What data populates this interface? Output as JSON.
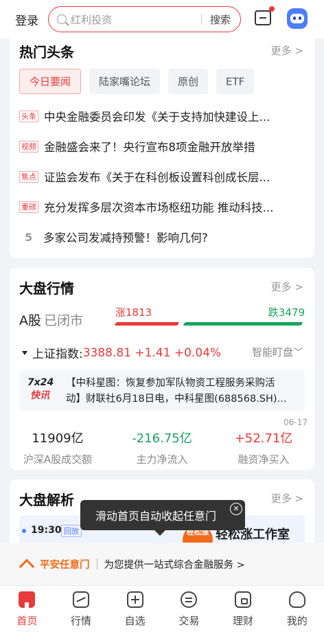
{
  "header": {
    "login": "登录",
    "search_placeholder": "红利投资",
    "search_button": "搜索"
  },
  "hot": {
    "title": "热门头条",
    "more": "更多 >",
    "tabs": [
      "今日要闻",
      "陆家嘴论坛",
      "原创",
      "ETF"
    ],
    "news": [
      {
        "tag": "头条",
        "text": "中央金融委员会印发《关于支持加快建设上..."
      },
      {
        "tag": "视频",
        "text": "金融盛会来了！央行宣布8项金融开放举措"
      },
      {
        "tag": "焦点",
        "text": "证监会发布《关于在科创板设置科创成长层..."
      },
      {
        "tag": "重磅",
        "text": "充分发挥多层次资本市场枢纽功能 推动科技..."
      },
      {
        "num": "5",
        "text": "多家公司发减持预警！影响几何?"
      }
    ]
  },
  "market": {
    "title": "大盘行情",
    "more": "更多 >",
    "ashare": "A股",
    "status": "已闭市",
    "rise_label": "涨1813",
    "fall_label": "跌3479",
    "rise_count": 1813,
    "fall_count": 3479,
    "index_name": "上证指数:",
    "index_value": "3388.81 +1.41 +0.04%",
    "smart": "智能盯盘﹀",
    "flash_logo_top": "7x24",
    "flash_logo_bottom": "快讯",
    "flash_line1": "【中科星图：恢复参加军队物资工程服务采购活",
    "flash_line2": "动】财联社6月18日电，中科星图(688568.SH)...",
    "date": "06-17",
    "stats": [
      {
        "value": "11909亿",
        "label": "沪深A股成交额",
        "color": "#222222"
      },
      {
        "value": "-216.75亿",
        "label": "主力净流入",
        "color": "#1aa260"
      },
      {
        "value": "+52.71亿",
        "label": "融资净买入",
        "color": "#e83a3a"
      }
    ]
  },
  "analysis": {
    "title": "大盘解析",
    "more": "更多 >",
    "time": "19:30",
    "replay": "回放",
    "avatar_text": "轻松涨",
    "studio": "轻松涨工作室"
  },
  "tooltip": {
    "text": "滑动首页自动收起任意门",
    "close": "✕"
  },
  "promo": {
    "brand": "平安任意门",
    "desc": "为您提供一站式综合金融服务 >"
  },
  "tabbar": [
    "首页",
    "行情",
    "自选",
    "交易",
    "理财",
    "我的"
  ],
  "colors": {
    "accent": "#e83a3a",
    "up": "#e83a3a",
    "down": "#1aa260",
    "brand_orange": "#f26a1b"
  }
}
